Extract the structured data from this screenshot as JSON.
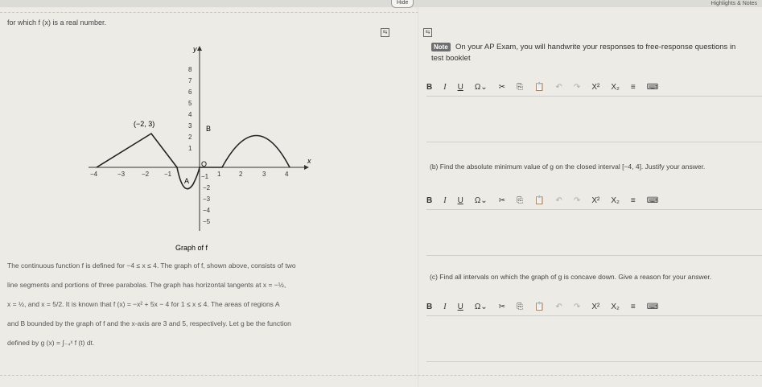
{
  "topbar": {
    "hide_label": "Hide",
    "highlights_label": "Highlights & Notes"
  },
  "left": {
    "intro": "for which f (x) is a real number.",
    "graph": {
      "y_axis_label": "y",
      "x_axis_label": "x",
      "x_ticks": [
        "−4",
        "−3",
        "−2",
        "−1",
        "1",
        "2",
        "3",
        "4"
      ],
      "y_ticks": [
        "8",
        "7",
        "6",
        "5",
        "4",
        "3",
        "2",
        "1",
        "−1",
        "−2",
        "−3",
        "−4",
        "−5"
      ],
      "origin_label": "O",
      "point_label": "(−2, 3)",
      "region_a": "A",
      "region_b": "B",
      "caption": "Graph of f"
    },
    "paragraph": [
      "The continuous function f is defined for −4 ≤ x ≤ 4. The graph of f, shown above, consists of two",
      "line segments and portions of three parabolas. The graph has horizontal tangents at x = −½,",
      "x = ½, and x = 5/2. It is known that f (x) = −x² + 5x − 4 for 1 ≤ x ≤ 4. The areas of regions A",
      "and B bounded by the graph of f and the x-axis are 3 and 5, respectively. Let g be the function",
      "defined by g (x) = ∫₋₄ˣ f (t) dt."
    ]
  },
  "right": {
    "note_badge": "Note",
    "note_text_1": "On your AP Exam, you will handwrite your responses to free-response questions in",
    "note_text_2": "test booklet",
    "toolbar": {
      "bold": "B",
      "italic": "I",
      "underline": "U",
      "omega": "Ω",
      "chevron": "⌄",
      "cut": "✂",
      "copy": "⎘",
      "paste": "📋",
      "undo": "↶",
      "redo": "↷",
      "superscript": "X²",
      "subscript": "X₂",
      "list": "≡",
      "keyboard": "⌨"
    },
    "question_b": "(b) Find the absolute minimum value of g on the closed interval [−4, 4]. Justify your answer.",
    "question_c": "(c) Find all intervals on which the graph of g is concave down. Give a reason for your answer."
  }
}
